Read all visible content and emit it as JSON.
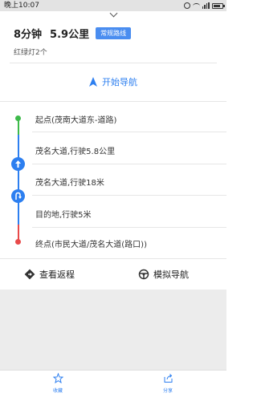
{
  "status_bar": {
    "time": "晚上10:07"
  },
  "summary": {
    "duration": "8分钟",
    "distance": "5.9公里",
    "route_tag": "常规路线",
    "traffic_lights": "红绿灯2个"
  },
  "start_nav": {
    "label": "开始导航"
  },
  "steps": [
    {
      "text": "起点(茂南大道东-道路)"
    },
    {
      "text": "茂名大道,行驶5.8公里"
    },
    {
      "text": "茂名大道,行驶18米"
    },
    {
      "text": "目的地,行驶5米"
    },
    {
      "text": "终点(市民大道/茂名大道(路口))"
    }
  ],
  "actions": {
    "return_route": "查看返程",
    "simulate_nav": "模拟导航"
  },
  "bottom_tabs": {
    "favorite": "收藏",
    "share": "分享"
  },
  "colors": {
    "accent": "#2d7ff0",
    "start": "#3dba4a",
    "end": "#e84a4a",
    "tag_bg": "#4a8df0"
  }
}
